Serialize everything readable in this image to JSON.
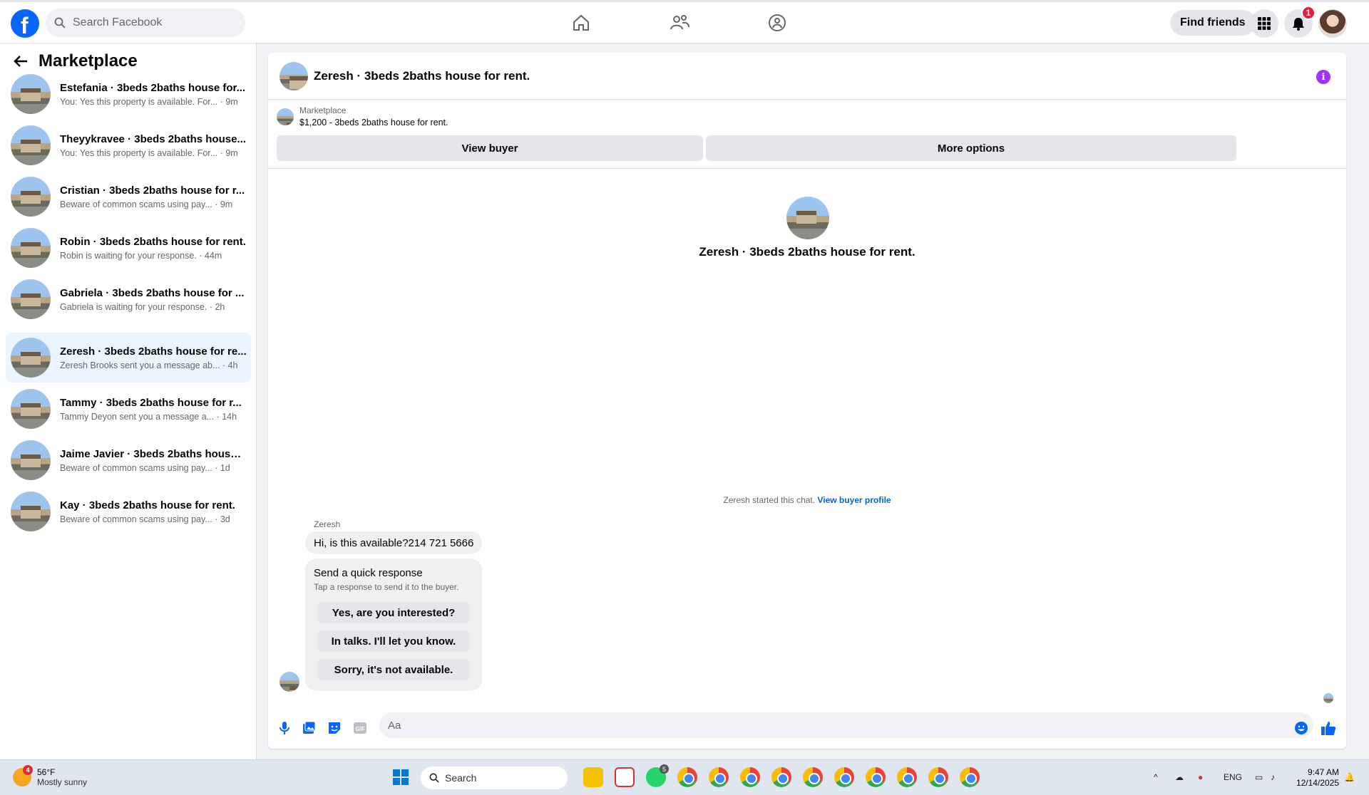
{
  "topbar": {
    "search_placeholder": "Search Facebook",
    "find_friends": "Find friends",
    "notification_count": "1"
  },
  "sidebar": {
    "title": "Marketplace",
    "conversations": [
      {
        "title": "Estefania · 3beds 2baths house for...",
        "preview": "You: Yes this property is available. For...",
        "time": "9m"
      },
      {
        "title": "Theyykravee · 3beds 2baths house...",
        "preview": "You: Yes this property is available. For...",
        "time": "9m"
      },
      {
        "title": "Cristian · 3beds 2baths house for r...",
        "preview": "Beware of common scams using pay...",
        "time": "9m"
      },
      {
        "title": "Robin · 3beds 2baths house for rent.",
        "preview": "Robin is waiting for your response.",
        "time": "44m"
      },
      {
        "title": "Gabriela · 3beds 2baths house for ...",
        "preview": "Gabriela is waiting for your response.",
        "time": "2h"
      },
      {
        "title": "Zeresh · 3beds 2baths house for re...",
        "preview": "Zeresh Brooks sent you a message ab...",
        "time": "4h"
      },
      {
        "title": "Tammy · 3beds 2baths house for r...",
        "preview": "Tammy Deyon sent you a message a...",
        "time": "14h"
      },
      {
        "title": "Jaime Javier · 3beds 2baths house ...",
        "preview": "Beware of common scams using pay...",
        "time": "1d"
      },
      {
        "title": "Kay · 3beds 2baths house for rent.",
        "preview": "Beware of common scams using pay...",
        "time": "3d"
      }
    ]
  },
  "chat": {
    "header_title": "Zeresh · 3beds 2baths house for rent.",
    "marketplace_label": "Marketplace",
    "listing": "$1,200 - 3beds 2baths house for rent.",
    "view_buyer": "View buyer",
    "more_options": "More options",
    "center_title": "Zeresh · 3beds 2baths house for rent.",
    "started_text": "Zeresh started this chat.",
    "view_buyer_profile": "View buyer profile",
    "sender": "Zeresh",
    "message": "Hi, is this available?214 721 5666",
    "quick_title": "Send a quick response",
    "quick_subtitle": "Tap a response to send it to the buyer.",
    "quick_replies": [
      "Yes, are you interested?",
      "In talks. I'll let you know.",
      "Sorry, it's not available."
    ],
    "composer_placeholder": "Aa"
  },
  "taskbar": {
    "temperature": "56°F",
    "condition": "Mostly sunny",
    "weather_badge": "4",
    "search_label": "Search",
    "whatsapp_badge": "5",
    "language": "ENG",
    "time": "9:47 AM",
    "date": "12/14/2025"
  }
}
